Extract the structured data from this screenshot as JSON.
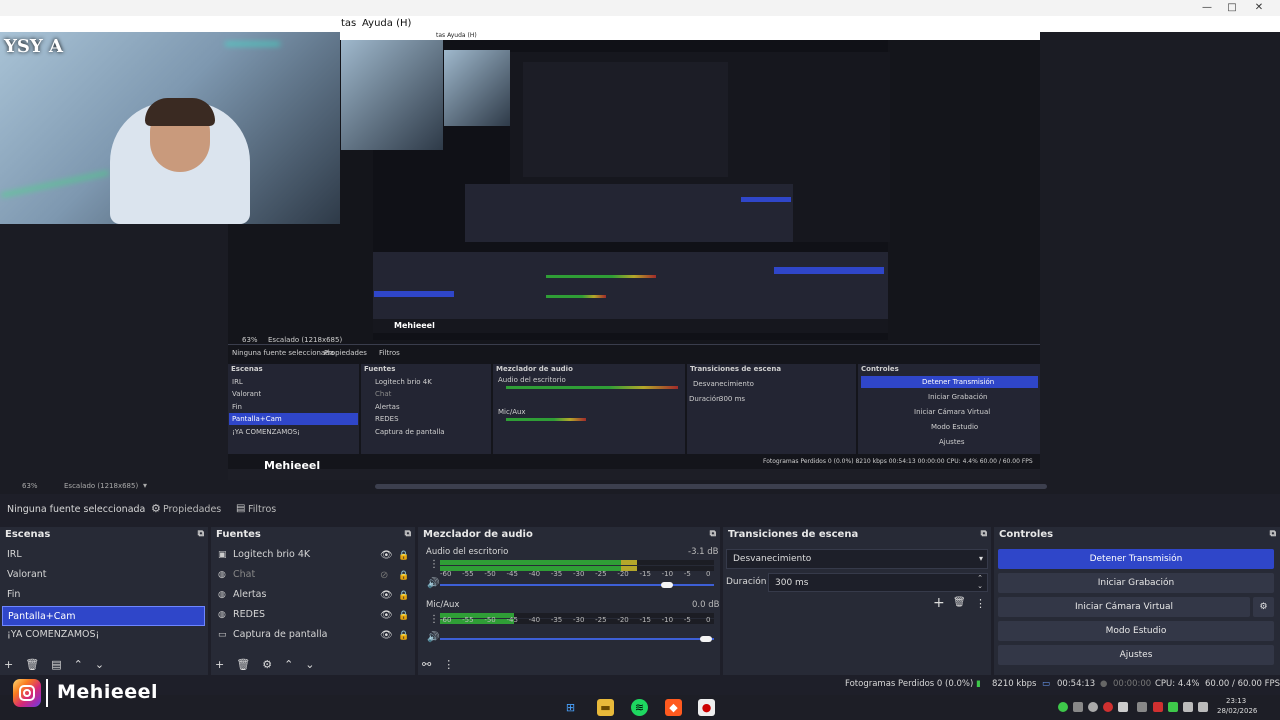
{
  "window": {
    "menu_partial": "tas",
    "menu_help": "Ayuda (H)",
    "minimize": "—",
    "maximize": "□",
    "close": "✕"
  },
  "webcam": {
    "logo_text": "YSY A"
  },
  "nested_preview": {
    "menu_text": "tas  Ayuda (H)",
    "selection_text": "Ninguna fuente seleccionada",
    "properties": "Propiedades",
    "filters": "Filtros",
    "zoom": "63%",
    "scale": "Escalado (1218x685)",
    "scenes_title": "Escenas",
    "sources_title": "Fuentes",
    "mixer_title": "Mezclador de audio",
    "transitions_title": "Transiciones de escena",
    "controls_title": "Controles",
    "scenes": [
      "IRL",
      "Valorant",
      "Fin",
      "Pantalla+Cam",
      "¡YA COMENZAMOS¡"
    ],
    "sources": [
      "Logitech brio 4K",
      "Chat",
      "Alertas",
      "REDES",
      "Captura de pantalla"
    ],
    "desktop_audio": "Audio del escritorio",
    "mic": "Mic/Aux",
    "transition": "Desvanecimiento",
    "duration_label": "Duración",
    "duration": "300 ms",
    "controls": [
      "Detener Transmisión",
      "Iniciar Grabación",
      "Iniciar Cámara Virtual",
      "Modo Estudio",
      "Ajustes"
    ],
    "brand": "Mehieeel",
    "status": "Fotogramas Perdidos 0 (0.0%)   8210 kbps   00:54:13   00:00:00   CPU: 4.4%   60.00 / 60.00 FPS"
  },
  "preview_footer": {
    "zoom": "63%",
    "scale": "Escalado (1218x685)"
  },
  "properties_bar": {
    "selection": "Ninguna fuente seleccionada",
    "properties": "Propiedades",
    "filters": "Filtros"
  },
  "scenes": {
    "title": "Escenas",
    "items": [
      "IRL",
      "Valorant",
      "Fin",
      "Pantalla+Cam",
      "¡YA COMENZAMOS¡"
    ],
    "selected_index": 3
  },
  "sources": {
    "title": "Fuentes",
    "items": [
      {
        "label": "Logitech brio 4K",
        "icon": "camera-icon",
        "visible": true
      },
      {
        "label": "Chat",
        "icon": "browser-icon",
        "visible": false
      },
      {
        "label": "Alertas",
        "icon": "browser-icon",
        "visible": true
      },
      {
        "label": "REDES",
        "icon": "browser-icon",
        "visible": true
      },
      {
        "label": "Captura de pantalla",
        "icon": "monitor-icon",
        "visible": true
      }
    ]
  },
  "mixer": {
    "title": "Mezclador de audio",
    "channels": [
      {
        "name": "Audio del escritorio",
        "db": "-3.1 dB",
        "level": 0.72,
        "volume": 0.83
      },
      {
        "name": "Mic/Aux",
        "db": "0.0 dB",
        "level": 0.27,
        "volume": 0.97
      }
    ],
    "ticks": [
      "-60",
      "-55",
      "-50",
      "-45",
      "-40",
      "-35",
      "-30",
      "-25",
      "-20",
      "-15",
      "-10",
      "-5",
      "0"
    ]
  },
  "transitions": {
    "title": "Transiciones de escena",
    "selected": "Desvanecimiento",
    "duration_label": "Duración",
    "duration_value": "300 ms"
  },
  "controls": {
    "title": "Controles",
    "buttons": [
      "Detener Transmisión",
      "Iniciar Grabación",
      "Iniciar Cámara Virtual",
      "Modo Estudio",
      "Ajustes"
    ]
  },
  "status": {
    "dropped_frames": "Fotogramas Perdidos 0 (0.0%)",
    "bitrate": "8210 kbps",
    "stream_time": "00:54:13",
    "record_time": "00:00:00",
    "cpu": "CPU: 4.4%",
    "fps": "60.00 / 60.00 FPS"
  },
  "overlay": {
    "brand": "Mehieeel"
  },
  "taskbar": {
    "time": "23:13",
    "date": "28/02/2026"
  },
  "colors": {
    "accent": "#2f46c9",
    "meter_green": "#2f9e36",
    "meter_yellow": "#b4a72a",
    "meter_red": "#a12a2a"
  }
}
